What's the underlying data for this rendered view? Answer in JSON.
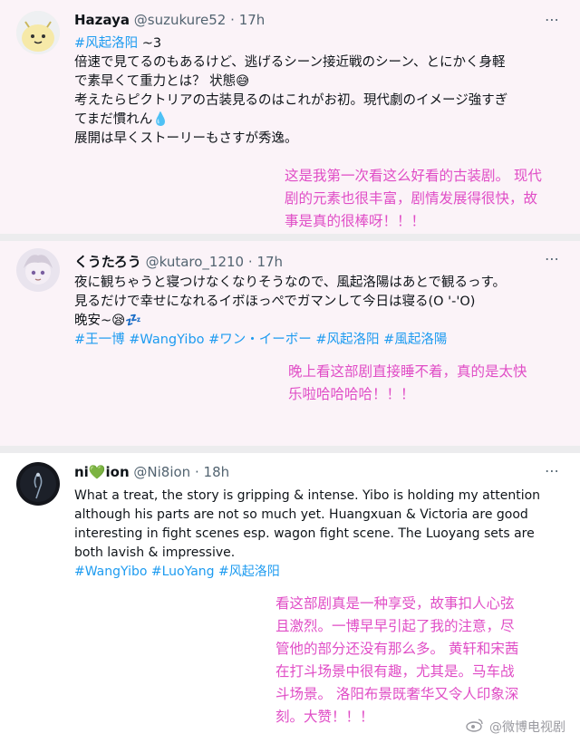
{
  "posts": [
    {
      "name": "Hazaya",
      "handle": "@suzukure52",
      "time": "17h",
      "lines": [
        {
          "tag": "#风起洛阳",
          "text": " ~3"
        },
        {
          "text": "倍速で見てるのもあるけど、逃げるシーン接近戦のシーン、とにかく身軽"
        },
        {
          "text": "で素早くて重力とは？ 状態😅"
        },
        {
          "text": "考えたらピクトリアの古装見るのはこれがお初。現代劇のイメージ強すぎ"
        },
        {
          "text": "てまだ慣れん💧"
        },
        {
          "text": "展開は早くストーリーもさすが秀逸。"
        }
      ],
      "note": [
        "这是我第一次看这么好看的古装剧。 现代",
        "剧的元素也很丰富，剧情发展得很快，故",
        "事是真的很棒呀！！！"
      ]
    },
    {
      "name": "くうたろう",
      "handle": "@kutaro_1210",
      "time": "17h",
      "lines": [
        {
          "text": "夜に観ちゃうと寝つけなくなりそうなので、風起洛陽はあとで観るっす。"
        },
        {
          "text": "見るだけで幸せになれるイボほっぺでガマンして今日は寝る(O '-'O)"
        },
        {
          "text": "晚安~😪💤"
        }
      ],
      "tags": "#王一博 #WangYibo #ワン・イーボー #风起洛阳 #風起洛陽",
      "note": [
        "晚上看这部剧直接睡不着，真的是太快",
        "乐啦哈哈哈哈！！！"
      ]
    },
    {
      "name": "ni💚ion",
      "handle": "@Ni8ion",
      "time": "18h",
      "lines": [
        {
          "text": "What a treat, the story is gripping & intense. Yibo is holding my attention"
        },
        {
          "text": "although his parts are not so much yet. Huangxuan & Victoria are good"
        },
        {
          "text": "interesting in fight scenes esp. wagon fight scene. The  Luoyang sets are"
        },
        {
          "text": "both lavish & impressive."
        }
      ],
      "tags": "#WangYibo #LuoYang #风起洛阳",
      "note": [
        "看这部剧真是一种享受，故事扣人心弦",
        "且激烈。一博早早引起了我的注意，尽",
        "管他的部分还没有那么多。 黄轩和宋茜",
        "在打斗场景中很有趣，尤其是。马车战",
        "斗场景。 洛阳布景既奢华又令人印象深",
        "刻。大赞！！！"
      ]
    }
  ],
  "more_icon": "⋯",
  "dot": "·",
  "watermark": "@微博电视剧"
}
